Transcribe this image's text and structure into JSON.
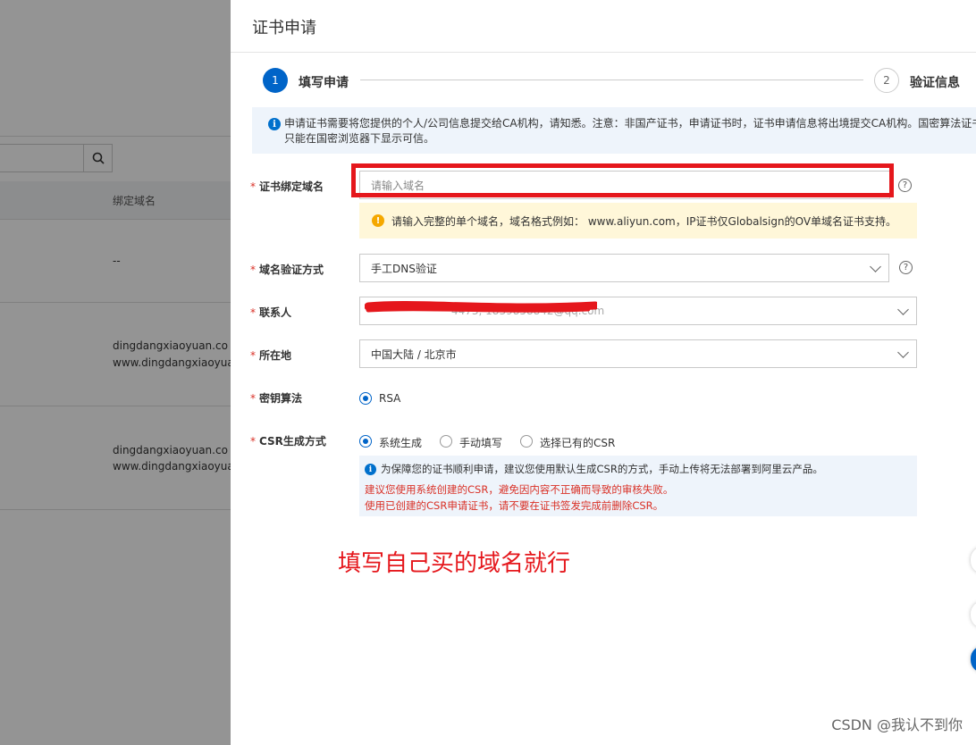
{
  "background": {
    "table_header": "绑定域名",
    "rows": [
      {
        "line1": "--",
        "line2": ""
      },
      {
        "line1": "dingdangxiaoyuan.co",
        "line2": "www.dingdangxiaoyuan.c"
      },
      {
        "line1": "dingdangxiaoyuan.co",
        "line2": "www.dingdangxiaoyuan.c"
      }
    ]
  },
  "drawer": {
    "title": "证书申请",
    "steps": [
      {
        "number": "1",
        "label": "填写申请"
      },
      {
        "number": "2",
        "label": "验证信息"
      }
    ],
    "info_banner": {
      "line1": "申请证书需要将您提供的个人/公司信息提交给CA机构，请知悉。注意：非国产证书，申请证书时，证书申请信息将出境提交CA机构。国密算法证书",
      "line2": "只能在国密浏览器下显示可信。"
    },
    "form": {
      "domain": {
        "label": "证书绑定域名",
        "placeholder": "请输入域名",
        "help": "?",
        "warning": "请输入完整的单个域名，域名格式例如： www.aliyun.com，IP证书仅Globalsign的OV单域名证书支持。"
      },
      "verify_method": {
        "label": "域名验证方式",
        "value": "手工DNS验证",
        "help": "?"
      },
      "contact": {
        "label": "联系人",
        "value": "4473, 1839858842@qq.com"
      },
      "location": {
        "label": "所在地",
        "value": "中国大陆 / 北京市"
      },
      "key_algorithm": {
        "label": "密钥算法",
        "options": [
          "RSA"
        ],
        "selected": 0
      },
      "csr_method": {
        "label": "CSR生成方式",
        "options": [
          "系统生成",
          "手动填写",
          "选择已有的CSR"
        ],
        "selected": 0,
        "note": {
          "info": "为保障您的证书顺利申请，建议您使用默认生成CSR的方式，手动上传将无法部署到阿里云产品。",
          "warn1": "建议您使用系统创建的CSR，避免因内容不正确而导致的审核失败。",
          "warn2": "使用已创建的CSR申请证书，请不要在证书签发完成前删除CSR。"
        }
      }
    },
    "annotation": "填写自己买的域名就行"
  },
  "watermark": "CSDN @我认不到你",
  "colors": {
    "primary": "#0064c8",
    "highlight_red": "#e5171c",
    "warning_bg": "#fff7d9",
    "info_bg": "#eef4fb",
    "error_text": "#d93026"
  }
}
